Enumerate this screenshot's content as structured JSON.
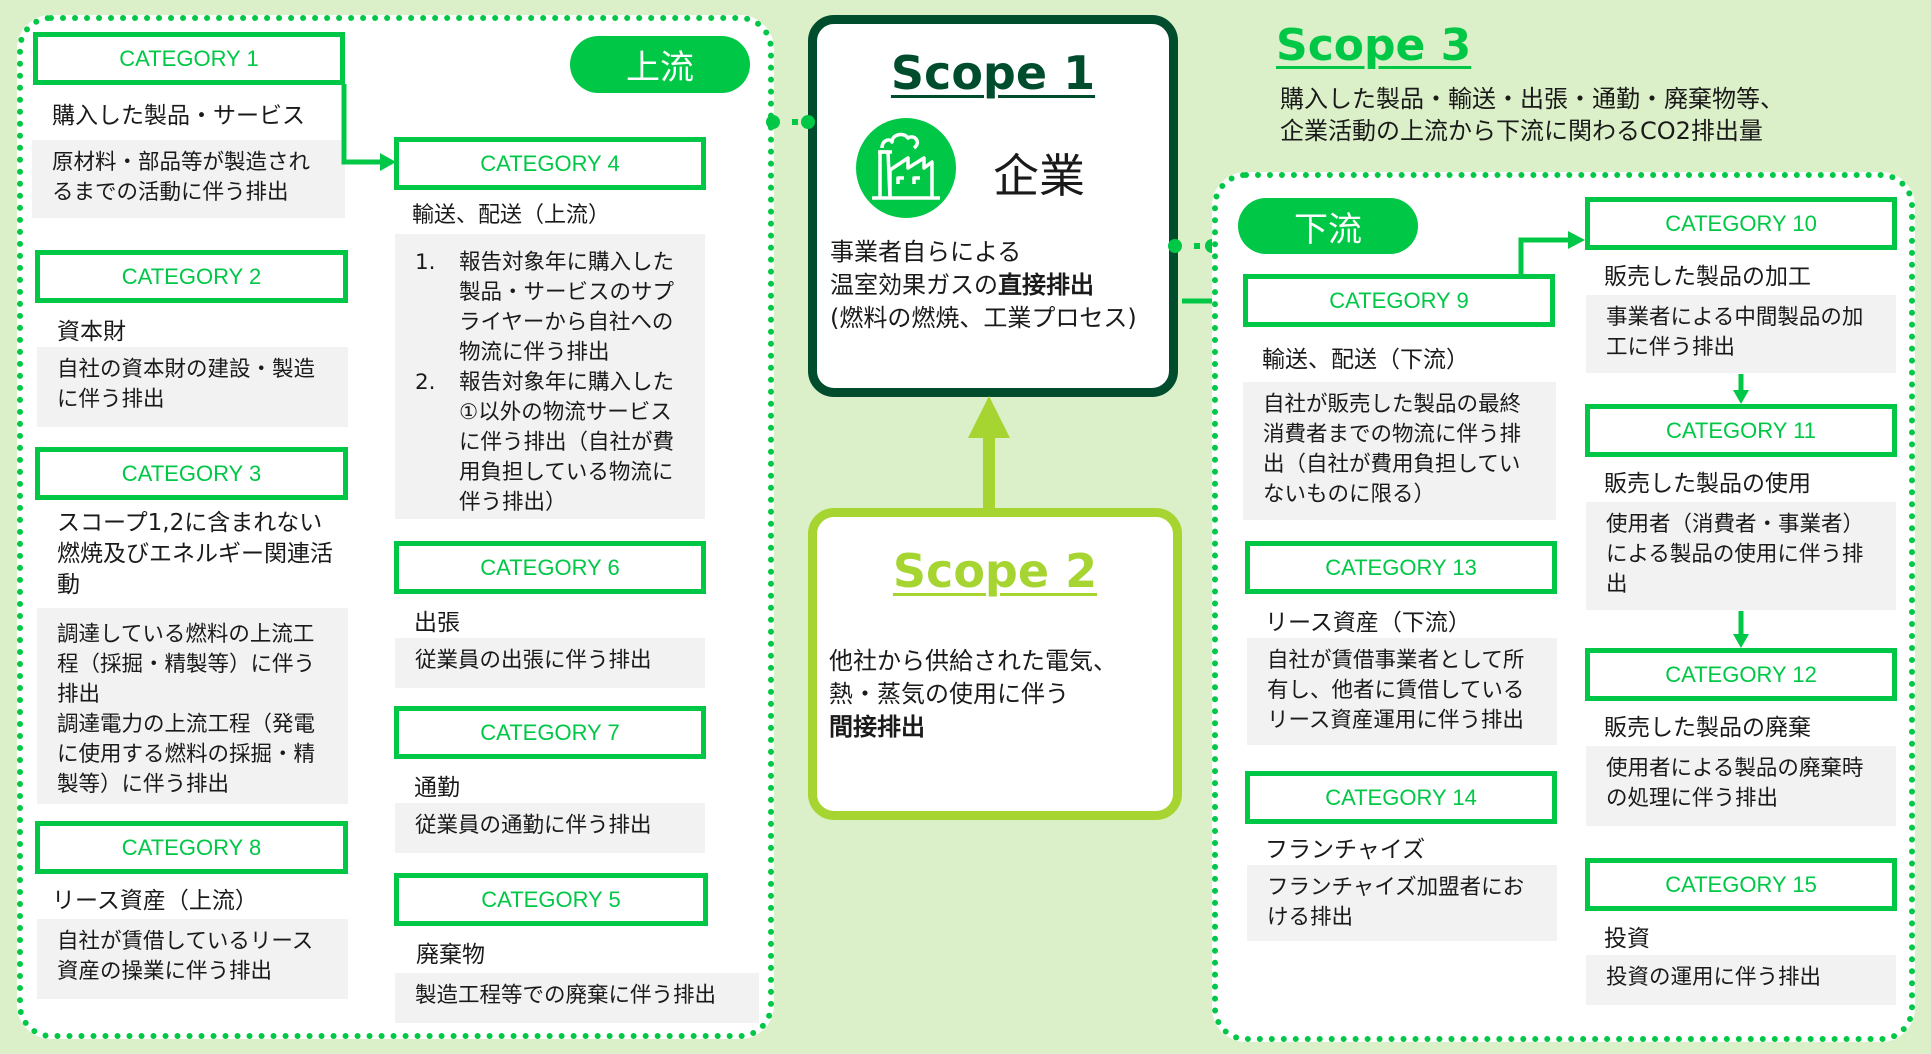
{
  "colors": {
    "background": "#dbf0c8",
    "accent_green": "#00c846",
    "scope1_border": "#004d2e",
    "scope2_border": "#a6d532",
    "desc_background": "#f2f2f2"
  },
  "upstream": {
    "label": "上流",
    "categories": {
      "c1": {
        "label": "CATEGORY 1",
        "title": "購入した製品・サービス",
        "desc": "原材料・部品等が製造されるまでの活動に伴う排出"
      },
      "c2": {
        "label": "CATEGORY 2",
        "title": "資本財",
        "desc": "自社の資本財の建設・製造に伴う排出"
      },
      "c3": {
        "label": "CATEGORY 3",
        "title": "スコープ1,2に含まれない燃焼及びエネルギー関連活動",
        "desc": "調達している燃料の上流工程（採掘・精製等）に伴う排出\n調達電力の上流工程（発電に使用する燃料の採掘・精製等）に伴う排出"
      },
      "c4": {
        "label": "CATEGORY 4",
        "title": "輸送、配送（上流）",
        "items": [
          {
            "num": "1.",
            "text": "報告対象年に購入した製品・サービスのサプライヤーから自社への物流に伴う排出"
          },
          {
            "num": "2.",
            "text": "報告対象年に購入した①以外の物流サービスに伴う排出（自社が費用負担している物流に伴う排出）"
          }
        ]
      },
      "c5": {
        "label": "CATEGORY 5",
        "title": "廃棄物",
        "desc": "製造工程等での廃棄に伴う排出"
      },
      "c6": {
        "label": "CATEGORY 6",
        "title": "出張",
        "desc": "従業員の出張に伴う排出"
      },
      "c7": {
        "label": "CATEGORY 7",
        "title": "通勤",
        "desc": "従業員の通勤に伴う排出"
      },
      "c8": {
        "label": "CATEGORY 8",
        "title": "リース資産（上流）",
        "desc": "自社が賃借しているリース資産の操業に伴う排出"
      }
    }
  },
  "scope1": {
    "title": "Scope 1",
    "icon": "factory-icon",
    "entity": "企業",
    "line1": "事業者自らによる",
    "line2_plain": "温室効果ガスの",
    "line2_bold": "直接排出",
    "line3": "(燃料の燃焼、工業プロセス)"
  },
  "scope2": {
    "title": "Scope 2",
    "line1": "他社から供給された電気、",
    "line2": "熱・蒸気の使用に伴う",
    "line3_bold": "間接排出"
  },
  "scope3": {
    "title": "Scope 3",
    "desc_line1": "購入した製品・輸送・出張・通勤・廃棄物等、",
    "desc_line2": "企業活動の上流から下流に関わるCO2排出量"
  },
  "downstream": {
    "label": "下流",
    "categories": {
      "c9": {
        "label": "CATEGORY 9",
        "title": "輸送、配送（下流）",
        "desc": "自社が販売した製品の最終消費者までの物流に伴う排出（自社が費用負担していないものに限る）"
      },
      "c10": {
        "label": "CATEGORY 10",
        "title": "販売した製品の加工",
        "desc": "事業者による中間製品の加工に伴う排出"
      },
      "c11": {
        "label": "CATEGORY 11",
        "title": "販売した製品の使用",
        "desc": "使用者（消費者・事業者）による製品の使用に伴う排出"
      },
      "c12": {
        "label": "CATEGORY 12",
        "title": "販売した製品の廃棄",
        "desc": "使用者による製品の廃棄時の処理に伴う排出"
      },
      "c13": {
        "label": "CATEGORY 13",
        "title": "リース資産（下流）",
        "desc": "自社が賃借事業者として所有し、他者に賃借しているリース資産運用に伴う排出"
      },
      "c14": {
        "label": "CATEGORY 14",
        "title": "フランチャイズ",
        "desc": "フランチャイズ加盟者における排出"
      },
      "c15": {
        "label": "CATEGORY 15",
        "title": "投資",
        "desc": "投資の運用に伴う排出"
      }
    }
  }
}
